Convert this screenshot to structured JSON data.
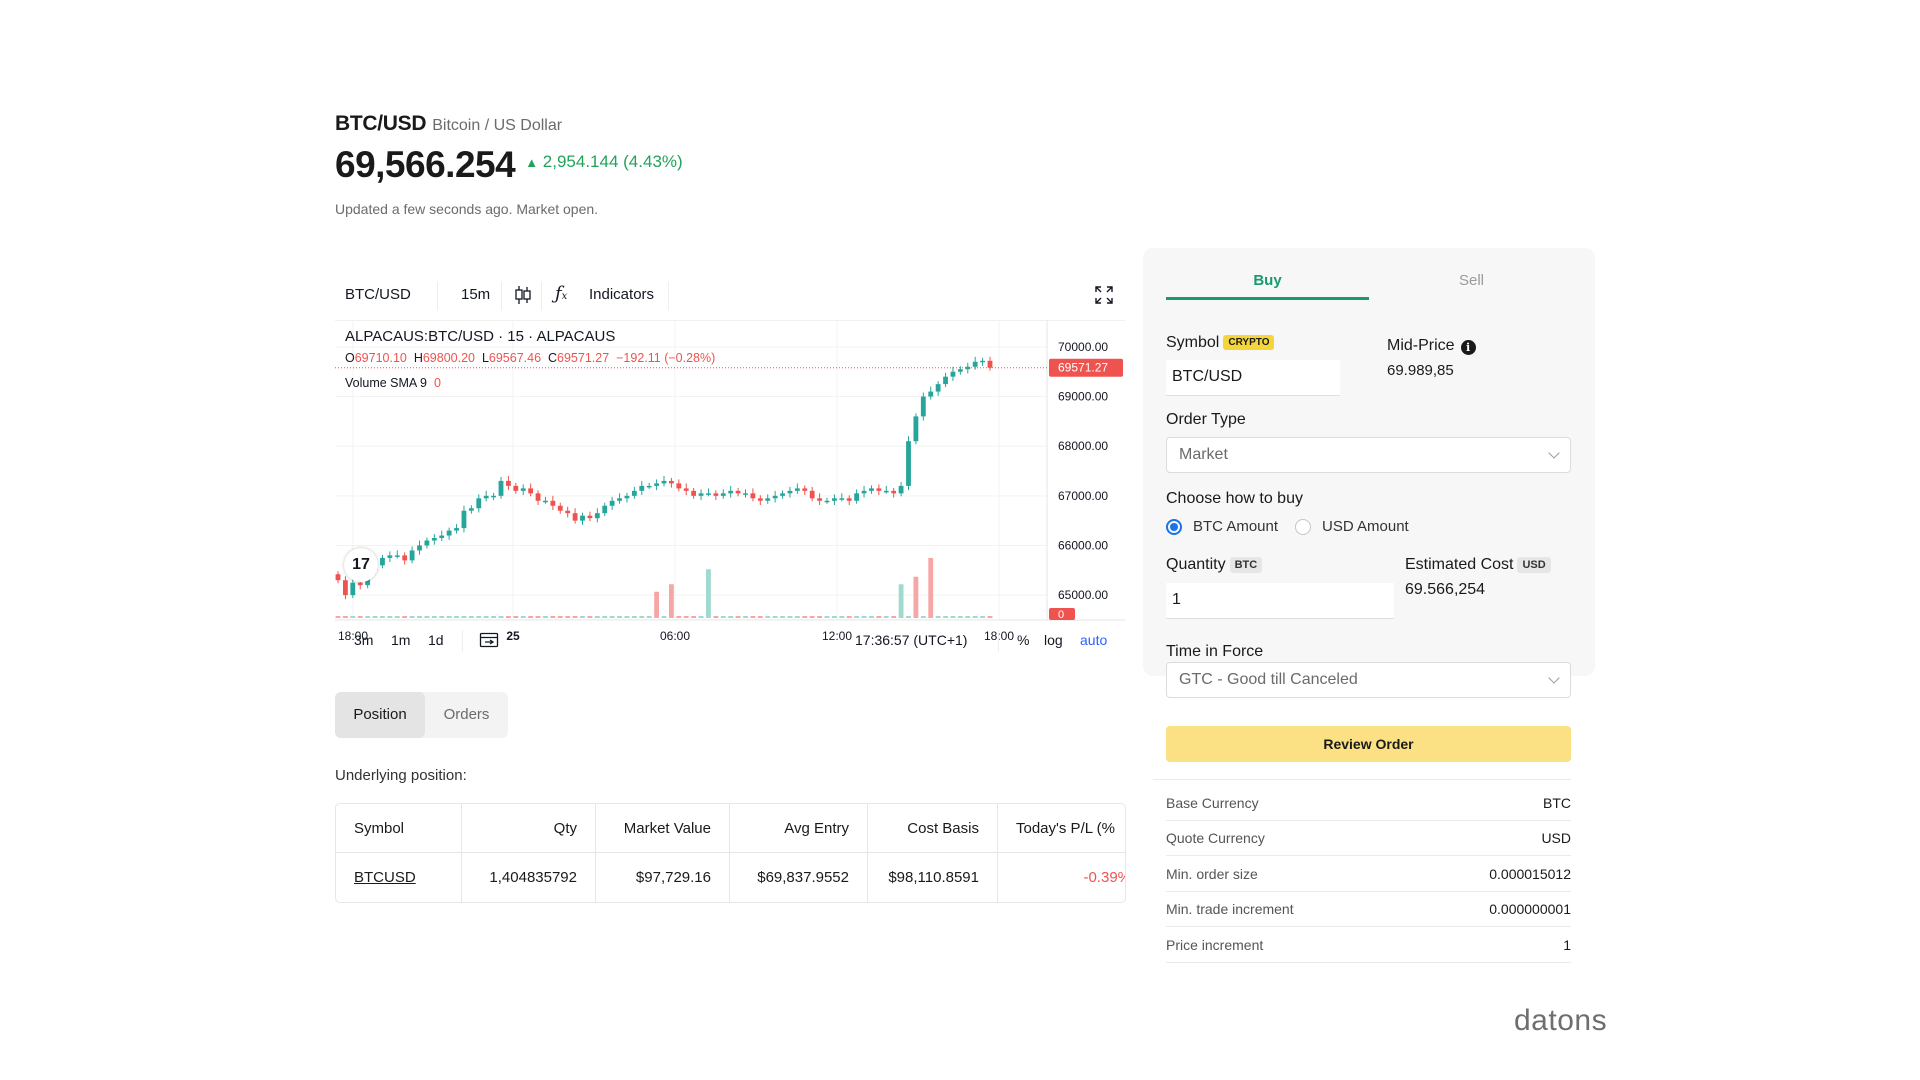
{
  "header": {
    "symbol": "BTC/USD",
    "description": "Bitcoin / US Dollar",
    "price": "69,566.254",
    "change_arrow": "▲",
    "change": "2,954.144 (4.43%)",
    "updated": "Updated a few seconds ago. Market open."
  },
  "chart": {
    "toolbar": {
      "symbol": "BTC/USD",
      "interval": "15m",
      "chart_type_icon": "candles-icon",
      "indicators_icon": "fx-icon",
      "indicators": "Indicators",
      "fullscreen_icon": "fullscreen-icon"
    },
    "legend": {
      "title": "ALPACAUS:BTC/USD · 15 · ALPACAUS",
      "o_label": "O",
      "o": "69710.10",
      "h_label": "H",
      "h": "69800.20",
      "l_label": "L",
      "l": "69567.46",
      "c_label": "C",
      "c": "69571.27",
      "chg": "−192.11 (−0.28%)",
      "volume": "Volume SMA 9",
      "volume_value": "0"
    },
    "price_axis": [
      "70000.00",
      "69000.00",
      "68000.00",
      "67000.00",
      "66000.00",
      "65000.00"
    ],
    "last_price_label": "69571.27",
    "volume_axis_label": "0",
    "time_axis": [
      "18:00",
      "25",
      "06:00",
      "12:00",
      "18:00"
    ],
    "bottom": {
      "ranges": [
        "3m",
        "1m",
        "1d"
      ],
      "goto_icon": "calendar-range-icon",
      "clock": "17:36:57 (UTC+1)",
      "percent": "%",
      "log": "log",
      "auto": "auto"
    },
    "colors": {
      "up": "#26a69a",
      "down": "#ef5350",
      "vol_up": "#9fd9cf",
      "vol_down": "#f7a6a6"
    }
  },
  "chart_data": {
    "type": "candlestick",
    "symbol": "BTC/USD",
    "interval": "15m",
    "ylim": [
      64700,
      70300
    ],
    "y_ticks": [
      70000,
      69000,
      68000,
      67000,
      66000,
      65000
    ],
    "x_ticks": [
      "18:00",
      "25",
      "06:00",
      "12:00",
      "18:00"
    ],
    "close_series": [
      65300,
      65000,
      65250,
      65200,
      65500,
      65600,
      65750,
      65800,
      65800,
      65700,
      65900,
      66000,
      66100,
      66150,
      66200,
      66300,
      66350,
      66700,
      66750,
      66950,
      67000,
      67000,
      67300,
      67200,
      67100,
      67150,
      67050,
      66900,
      66900,
      66800,
      66700,
      66650,
      66500,
      66600,
      66550,
      66650,
      66800,
      66900,
      66950,
      67000,
      67100,
      67200,
      67200,
      67250,
      67300,
      67250,
      67150,
      67100,
      67000,
      67050,
      67050,
      67000,
      67050,
      67100,
      67050,
      67050,
      66950,
      66900,
      66950,
      67000,
      67050,
      67100,
      67150,
      67100,
      66950,
      66900,
      66900,
      66950,
      66950,
      66900,
      67050,
      67100,
      67150,
      67100,
      67100,
      67050,
      67200,
      68100,
      68600,
      69000,
      69100,
      69250,
      69400,
      69500,
      69550,
      69600,
      69700,
      69720,
      69580
    ],
    "volume_spikes": [
      {
        "index": 43,
        "value": 0.35,
        "dir": "down"
      },
      {
        "index": 45,
        "value": 0.45,
        "dir": "down"
      },
      {
        "index": 50,
        "value": 0.65,
        "dir": "up"
      },
      {
        "index": 76,
        "value": 0.45,
        "dir": "up"
      },
      {
        "index": 78,
        "value": 0.55,
        "dir": "down"
      },
      {
        "index": 80,
        "value": 0.8,
        "dir": "down"
      }
    ]
  },
  "positions": {
    "tabs": [
      "Position",
      "Orders"
    ],
    "underlying_label": "Underlying position:",
    "columns": [
      "Symbol",
      "Qty",
      "Market Value",
      "Avg Entry",
      "Cost Basis",
      "Today's P/L (%"
    ],
    "rows": [
      [
        "BTCUSD",
        "1,404835792",
        "$97,729.16",
        "$69,837.9552",
        "$98,110.8591",
        "-0.39%"
      ]
    ]
  },
  "order": {
    "tabs": [
      "Buy",
      "Sell"
    ],
    "symbol_label": "Symbol",
    "symbol_badge": "CRYPTO",
    "symbol_value": "BTC/USD",
    "mid_label": "Mid-Price",
    "mid_value": "69.989,85",
    "info_icon": "info-icon",
    "order_type_label": "Order Type",
    "order_type_value": "Market",
    "how_label": "Choose how to buy",
    "radio_btc": "BTC Amount",
    "radio_usd": "USD Amount",
    "quantity_label": "Quantity",
    "quantity_badge": "BTC",
    "quantity_value": "1",
    "est_label": "Estimated Cost",
    "est_badge": "USD",
    "est_value": "69.566,254",
    "tif_label": "Time in Force",
    "tif_value": "GTC - Good till Canceled",
    "review": "Review Order",
    "specs": [
      {
        "k": "Base Currency",
        "v": "BTC"
      },
      {
        "k": "Quote Currency",
        "v": "USD"
      },
      {
        "k": "Min. order size",
        "v": "0.000015012"
      },
      {
        "k": "Min. trade increment",
        "v": "0.000000001"
      },
      {
        "k": "Price increment",
        "v": "1"
      }
    ],
    "colors": {
      "accent": "#1a9a6c",
      "button": "#fbe183",
      "crypto_badge": "#f5d63a"
    }
  },
  "watermark": "datons"
}
